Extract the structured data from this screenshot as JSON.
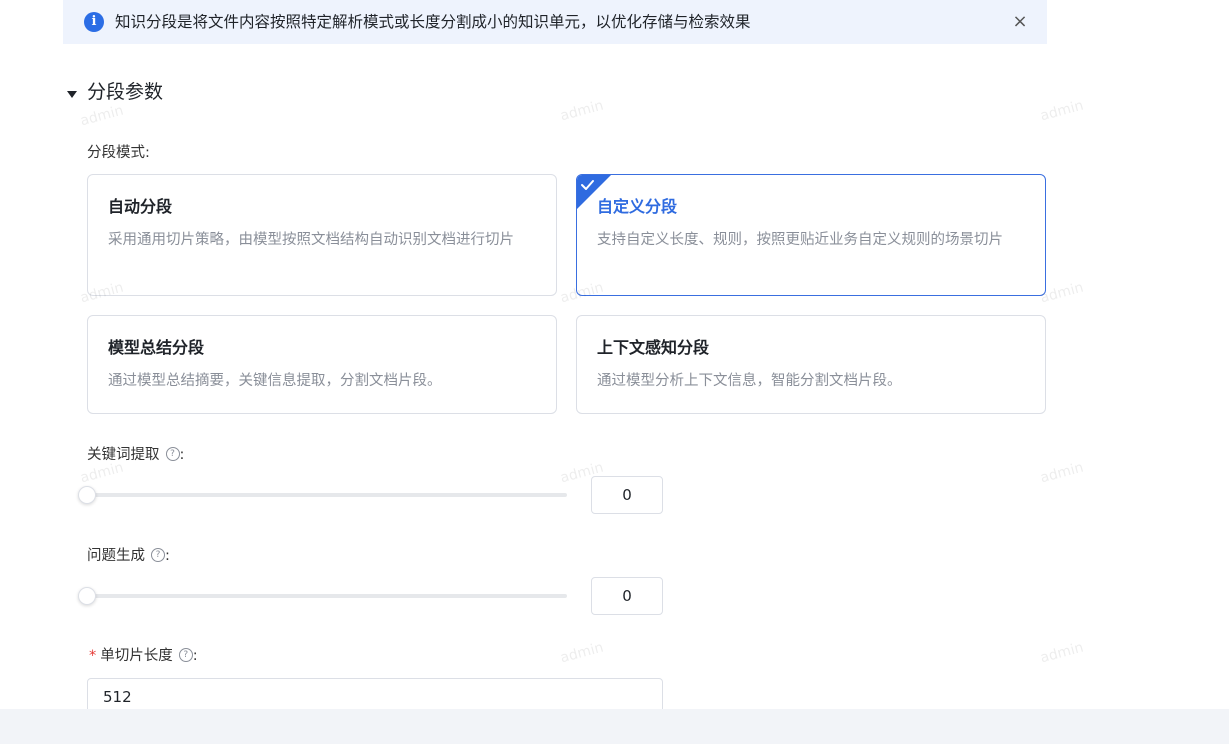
{
  "alert": {
    "text": "知识分段是将文件内容按照特定解析模式或长度分割成小的知识单元，以优化存储与检索效果",
    "close_icon": "×"
  },
  "section": {
    "title": "分段参数"
  },
  "segment_mode": {
    "label": "分段模式:",
    "selected": "自定义分段",
    "options": [
      {
        "title": "自动分段",
        "desc": "采用通用切片策略，由模型按照文档结构自动识别文档进行切片"
      },
      {
        "title": "自定义分段",
        "desc": "支持自定义长度、规则，按照更贴近业务自定义规则的场景切片"
      },
      {
        "title": "模型总结分段",
        "desc": "通过模型总结摘要，关键信息提取，分割文档片段。"
      },
      {
        "title": "上下文感知分段",
        "desc": "通过模型分析上下文信息，智能分割文档片段。"
      }
    ]
  },
  "keyword_extraction": {
    "label": "关键词提取",
    "colon": ":",
    "value": "0",
    "fraction": 0
  },
  "question_generation": {
    "label": "问题生成",
    "colon": ":",
    "value": "0",
    "fraction": 0
  },
  "chunk_length": {
    "required": "*",
    "label": "单切片长度",
    "colon": ":",
    "value": "512"
  },
  "help_glyph": "?",
  "watermark": "admin",
  "colors": {
    "accent": "#2f6be0",
    "alert_bg": "#eef3fd",
    "required": "#e53935"
  }
}
